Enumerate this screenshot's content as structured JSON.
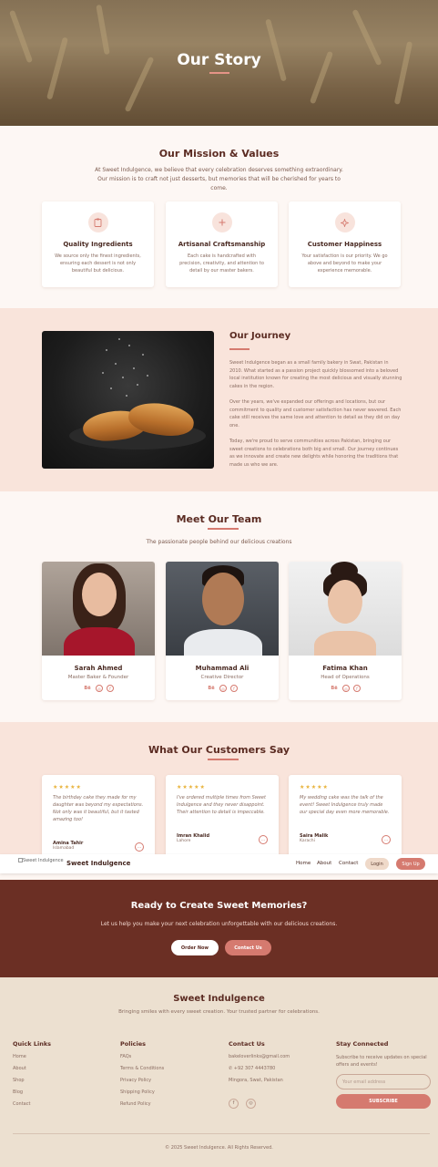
{
  "hero": {
    "title": "Our Story"
  },
  "mission": {
    "title": "Our Mission & Values",
    "intro": "At Sweet Indulgence, we believe that every celebration deserves something extraordinary. Our mission is to craft not just desserts, but memories that will be cherished for years to come.",
    "values": [
      {
        "icon": "clipboard-icon",
        "title": "Quality Ingredients",
        "text": "We source only the finest ingredients, ensuring each dessert is not only beautiful but delicious."
      },
      {
        "icon": "plus-icon",
        "title": "Artisanal Craftsmanship",
        "text": "Each cake is handcrafted with precision, creativity, and attention to detail by our master bakers."
      },
      {
        "icon": "sparkle-icon",
        "title": "Customer Happiness",
        "text": "Your satisfaction is our priority. We go above and beyond to make your experience memorable."
      }
    ]
  },
  "journey": {
    "title": "Our Journey",
    "paragraphs": [
      "Sweet Indulgence began as a small family bakery in Swat, Pakistan in 2010. What started as a passion project quickly blossomed into a beloved local institution known for creating the most delicious and visually stunning cakes in the region.",
      "Over the years, we've expanded our offerings and locations, but our commitment to quality and customer satisfaction has never wavered. Each cake still receives the same love and attention to detail as they did on day one.",
      "Today, we're proud to serve communities across Pakistan, bringing our sweet creations to celebrations both big and small. Our journey continues as we innovate and create new delights while honoring the traditions that made us who we are."
    ]
  },
  "team": {
    "title": "Meet Our Team",
    "subtitle": "The passionate people behind our delicious creations",
    "members": [
      {
        "name": "Sarah Ahmed",
        "role": "Master Baker & Founder"
      },
      {
        "name": "Muhammad Ali",
        "role": "Creative Director"
      },
      {
        "name": "Fatima Khan",
        "role": "Head of Operations"
      }
    ],
    "social_labels": [
      "Bē",
      "◎",
      "f"
    ]
  },
  "testimonials": {
    "title": "What Our Customers Say",
    "stars": "★★★★★",
    "items": [
      {
        "quote": "The birthday cake they made for my daughter was beyond my expectations. Not only was it beautiful, but it tasted amazing too!",
        "name": "Amina Tahir",
        "location": "Islamabad"
      },
      {
        "quote": "I've ordered multiple times from Sweet Indulgence and they never disappoint. Their attention to detail is impeccable.",
        "name": "Imran Khalid",
        "location": "Lahore"
      },
      {
        "quote": "My wedding cake was the talk of the event! Sweet Indulgence truly made our special day even more memorable.",
        "name": "Saira Malik",
        "location": "Karachi"
      }
    ]
  },
  "navbar": {
    "logo_alt": "Sweet Indulgence",
    "brand": "Sweet Indulgence",
    "links": [
      "Home",
      "About",
      "Contact"
    ],
    "login": "Login",
    "signup": "Sign Up"
  },
  "cta": {
    "title": "Ready to Create Sweet Memories?",
    "text": "Let us help you make your next celebration unforgettable with our delicious creations.",
    "order_button": "Order Now",
    "contact_button": "Contact Us"
  },
  "footer": {
    "brand": "Sweet Indulgence",
    "tagline": "Bringing smiles with every sweet creation. Your trusted partner for celebrations.",
    "quick_links": {
      "title": "Quick Links",
      "items": [
        "Home",
        "About",
        "Shop",
        "Blog",
        "Contact"
      ]
    },
    "policies": {
      "title": "Policies",
      "items": [
        "FAQs",
        "Terms & Conditions",
        "Privacy Policy",
        "Shipping Policy",
        "Refund Policy"
      ]
    },
    "contact": {
      "title": "Contact Us",
      "email": "bakeloverlinks@gmail.com",
      "phone": "+92 307 4443780",
      "address": "Mingora, Swat, Pakistan"
    },
    "stay": {
      "title": "Stay Connected",
      "text": "Subscribe to receive updates on special offers and events!",
      "placeholder": "Your email address",
      "button": "SUBSCRIBE"
    },
    "copyright": "© 2025 Sweet Indulgence. All Rights Reserved."
  },
  "colors": {
    "accent": "#d57a6f",
    "cta_bg": "#6b2f24",
    "footer_bg": "#ece0d0",
    "section_pink": "#f9e4db"
  }
}
